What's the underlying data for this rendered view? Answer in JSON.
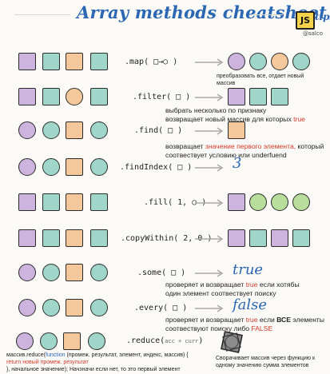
{
  "header": {
    "title": "Array methods cheatsheet",
    "badge_js": "JS",
    "badge_tips": "tips",
    "badge_handle": "@salco"
  },
  "rows": {
    "map": {
      "method_label": ".map( □→○ )",
      "desc": "преобразовать все, отдает новый массив"
    },
    "filter": {
      "method_label": ".filter( □ )",
      "desc_line1": "выбрать  несколько по признаку",
      "desc_line2_prefix": "возвращает новый массив для которых ",
      "desc_line2_highlight": "true"
    },
    "find": {
      "method_label": ".find( □ )",
      "desc_prefix": "возвращает ",
      "desc_highlight": "значение первого элемента,",
      "desc_suffix": " который соотвествует условию или underfuend"
    },
    "findIndex": {
      "method_label": ".findIndex( □ )",
      "result": "3"
    },
    "fill": {
      "method_label": ".fill( 1, ○ )"
    },
    "copyWithin": {
      "method_label": ".copyWithin( 2, 0 )"
    },
    "some": {
      "method_label": ".some( □ )",
      "result": "true",
      "desc_line1_prefix": "проверяет и возвращает ",
      "desc_line1_highlight": "true",
      "desc_line1_suffix": " если хотябы",
      "desc_line2": "один элемент соотвествует поиску"
    },
    "every": {
      "method_label": ".every( □ )",
      "result": "false",
      "desc_line1_prefix": "проверяет и возвращает ",
      "desc_line1_highlight": "true",
      "desc_line1_mid": " если ",
      "desc_line1_bold": "ВСЕ",
      "desc_line1_suffix": " элементы",
      "desc_line2_prefix": "соотвествуют поиску либо ",
      "desc_line2_highlight": "FALSE"
    },
    "reduce": {
      "method_label": ".reduce(",
      "method_args": "acc + curr",
      "method_close": ")",
      "desc_prefix": "Сворачивает массив через функцию к ",
      "desc_highlight": "одному значению",
      "desc_suffix": "    сумма элементов",
      "code_line1_prefix": "массив.reduce(",
      "code_line1_fn": "function",
      "code_line1_rest": " (промеж. результат, элемент, индекс, массив) {",
      "code_line2": "return новый промеж. результат",
      "code_line3_prefix": "}, начальное значение);",
      "code_line3_rest": "  Начзначи если нет, то это первый элемент"
    }
  },
  "colors": {
    "accent": "#2b67b3",
    "highlight": "#d23a2a",
    "purple": "#cdb4df",
    "teal": "#9fd6c9",
    "orange": "#f4c89a",
    "green": "#b9dd9a"
  }
}
